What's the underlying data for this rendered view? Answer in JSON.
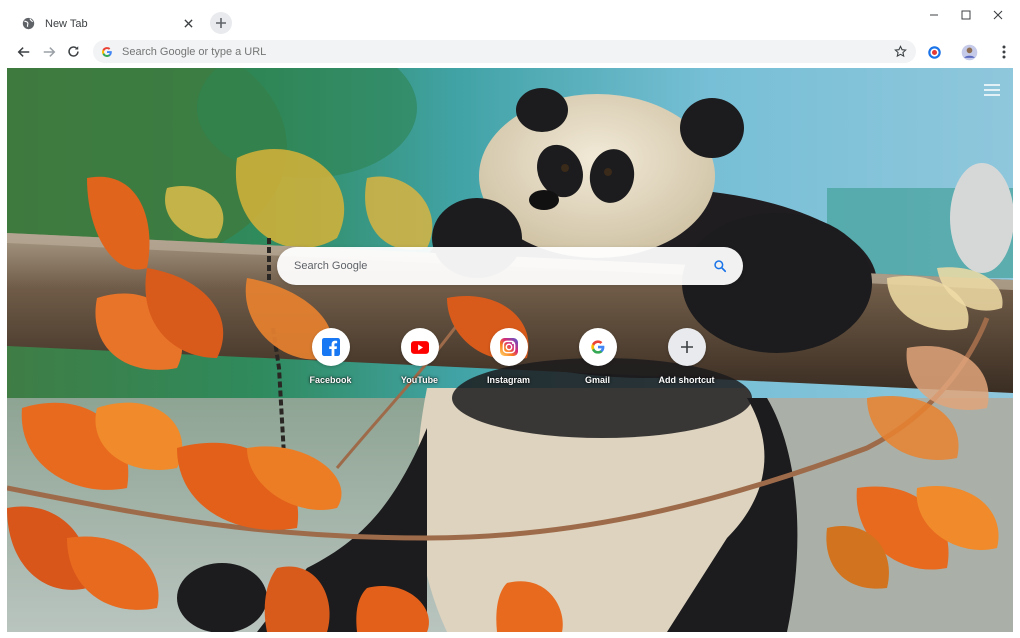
{
  "tab": {
    "title": "New Tab"
  },
  "omnibox": {
    "placeholder": "Search Google or type a URL"
  },
  "ntp": {
    "search_placeholder": "Search Google",
    "shortcuts": [
      {
        "label": "Facebook",
        "icon": "facebook-icon"
      },
      {
        "label": "YouTube",
        "icon": "youtube-icon"
      },
      {
        "label": "Instagram",
        "icon": "instagram-icon"
      },
      {
        "label": "Gmail",
        "icon": "google-icon"
      },
      {
        "label": "Add shortcut",
        "icon": "plus-icon"
      }
    ]
  },
  "colors": {
    "accent": "#1a73e8",
    "facebook": "#1877f2",
    "youtube": "#ff0000",
    "panda_black": "#1c1b1d",
    "leaf_orange": "#e0641c"
  }
}
